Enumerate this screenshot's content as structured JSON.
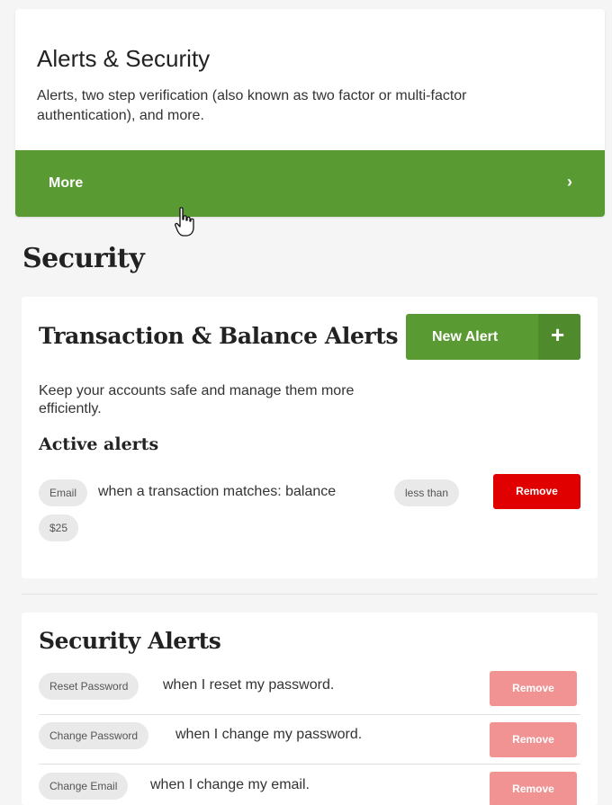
{
  "top_card": {
    "title": "Alerts & Security",
    "description": "Alerts, two step verification (also known as two factor or multi-factor authentication), and more.",
    "more_label": "More",
    "more_chevron": "›",
    "accent_color": "#5a9a32"
  },
  "section_title": "Security",
  "transaction_card": {
    "title": "Transaction & Balance Alerts",
    "new_alert_label": "New Alert",
    "new_alert_icon": "+",
    "description": "Keep your accounts safe and manage them more efficiently.",
    "active_alerts_title": "Active alerts",
    "alert": {
      "channel": "Email",
      "text": "when a transaction matches: balance",
      "operator": "less than",
      "amount": "$25",
      "remove_label": "Remove",
      "remove_color": "#e00000"
    }
  },
  "security_card": {
    "title": "Security Alerts",
    "rows": [
      {
        "pill": "Reset Password",
        "text": "when I reset my password.",
        "remove_label": "Remove"
      },
      {
        "pill": "Change Password",
        "text": "when I change my password.",
        "remove_label": "Remove"
      },
      {
        "pill": "Change Email",
        "text": "when I change my email.",
        "remove_label": "Remove"
      }
    ],
    "remove_color": "#f19393"
  }
}
